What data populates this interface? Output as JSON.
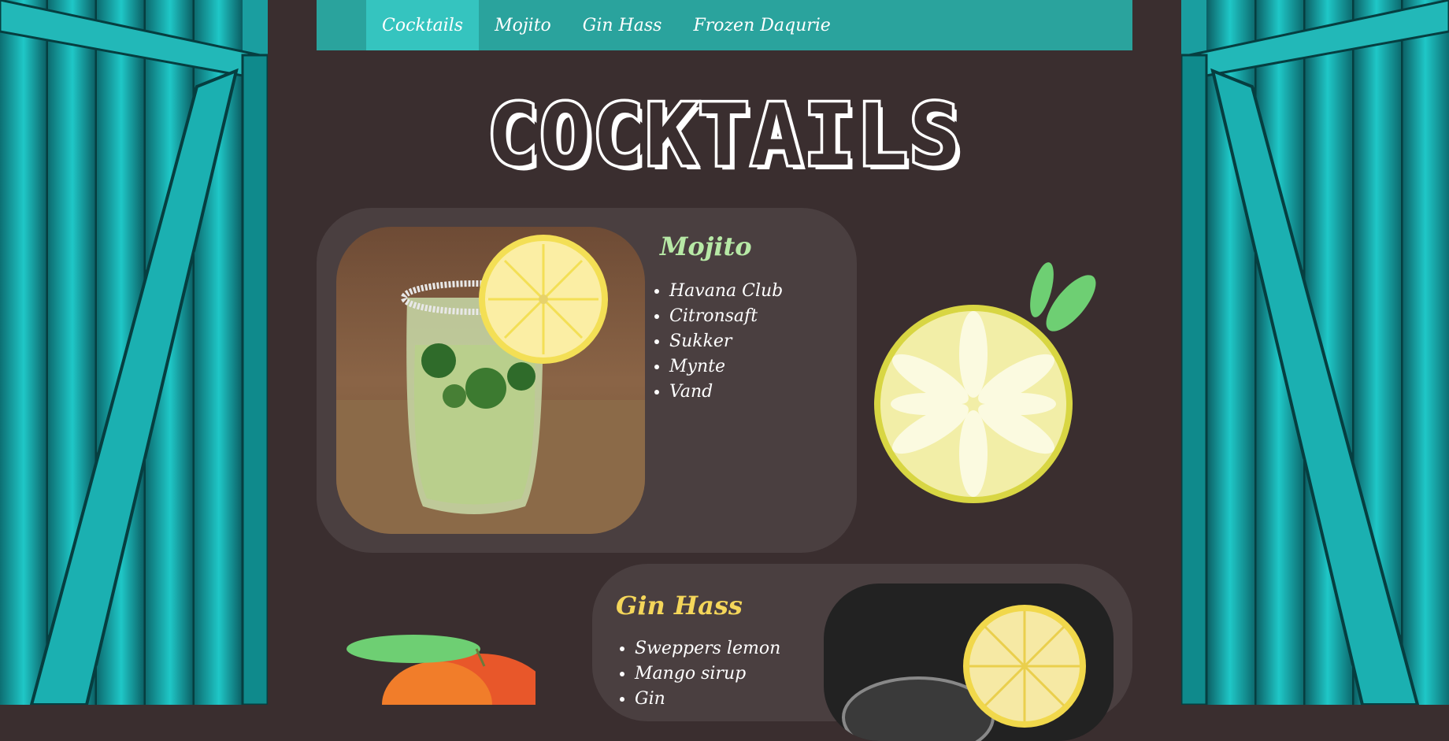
{
  "nav": {
    "items": [
      {
        "label": "Cocktails",
        "active": true
      },
      {
        "label": "Mojito",
        "active": false
      },
      {
        "label": "Gin Hass",
        "active": false
      },
      {
        "label": "Frozen Daqurie",
        "active": false
      }
    ]
  },
  "page": {
    "title": "COCKTAILS"
  },
  "cocktails": [
    {
      "name": "Mojito",
      "ingredients": [
        "Havana Club",
        "Citronsaft",
        "Sukker",
        "Mynte",
        "Vand"
      ]
    },
    {
      "name": "Gin Hass",
      "ingredients": [
        "Sweppers lemon",
        "Mango sirup",
        "Gin"
      ]
    }
  ],
  "colors": {
    "background": "#3a2e2f",
    "nav": "#2aa39d",
    "nav_active": "#35c4bf",
    "card": "#4a3f40",
    "mojito_title": "#b7e9a6",
    "ginhass_title": "#f4d65a"
  },
  "icons": {
    "lemon": "lemon-slice-icon",
    "mango": "mango-icon"
  }
}
